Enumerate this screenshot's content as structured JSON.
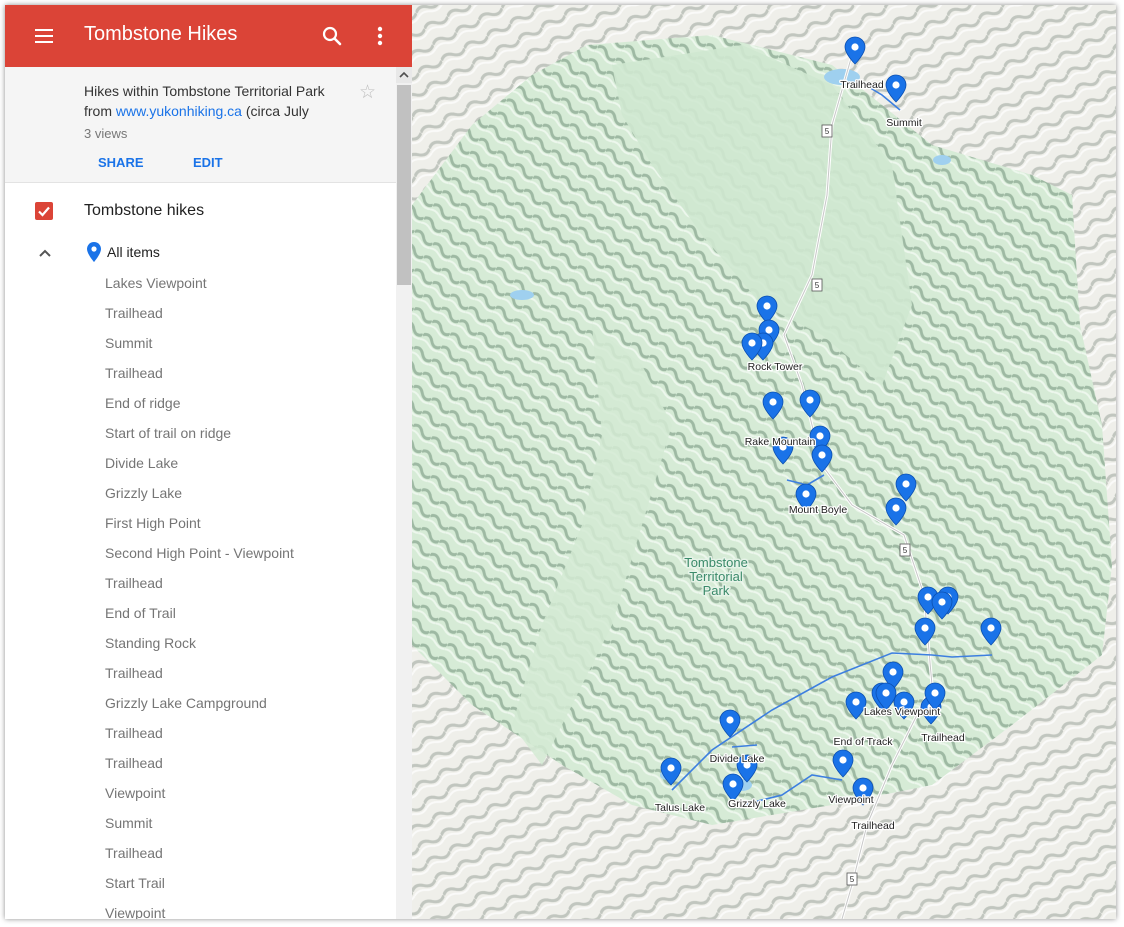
{
  "header": {
    "title": "Tombstone Hikes",
    "menu_icon": "menu-icon",
    "search_icon": "search-icon",
    "more_icon": "more-vert-icon"
  },
  "description": {
    "text_before_link": "Hikes within Tombstone Territorial Park from ",
    "link": "www.yukonhiking.ca",
    "text_after_link": " (circa July",
    "views": "3 views",
    "share_label": "SHARE",
    "edit_label": "EDIT",
    "star_icon": "star-outline-icon"
  },
  "layer": {
    "name": "Tombstone hikes",
    "checked": true,
    "all_items_label": "All items",
    "collapse_icon": "chevron-up-icon",
    "pin_icon": "map-pin-icon"
  },
  "items": [
    "Lakes Viewpoint",
    "Trailhead",
    "Summit",
    "Trailhead",
    "End of ridge",
    "Start of trail on ridge",
    "Divide Lake",
    "Grizzly Lake",
    "First High Point",
    "Second High Point - Viewpoint",
    "Trailhead",
    "End of Trail",
    "Standing Rock",
    "Trailhead",
    "Grizzly Lake Campground",
    "Trailhead",
    "Trailhead",
    "Viewpoint",
    "Summit",
    "Trailhead",
    "Start Trail",
    "Viewpoint"
  ],
  "map": {
    "park_label": [
      "Tombstone",
      "Territorial",
      "Park"
    ],
    "highway_label": "5",
    "pin_labels": {
      "trailhead_north": "Trailhead",
      "summit_north": "Summit",
      "rock_tower": "Rock Tower",
      "rake_mountain": "Rake Mountain",
      "mount_boyle": "Mount Boyle",
      "lakes_viewpoint": "Lakes Viewpoint",
      "end_of_track": "End of Track",
      "trailhead_east": "Trailhead",
      "divide_lake": "Divide Lake",
      "talus_lake": "Talus Lake",
      "grizzly_lake": "Grizzly Lake",
      "viewpoint": "Viewpoint",
      "trailhead_south": "Trailhead"
    },
    "colors": {
      "header": "#db4437",
      "link": "#1a73e8",
      "pin": "#1a73e8",
      "trail": "#3d7fe0",
      "park": "#c9e6cc",
      "terrain": "#f2f2ee"
    }
  }
}
